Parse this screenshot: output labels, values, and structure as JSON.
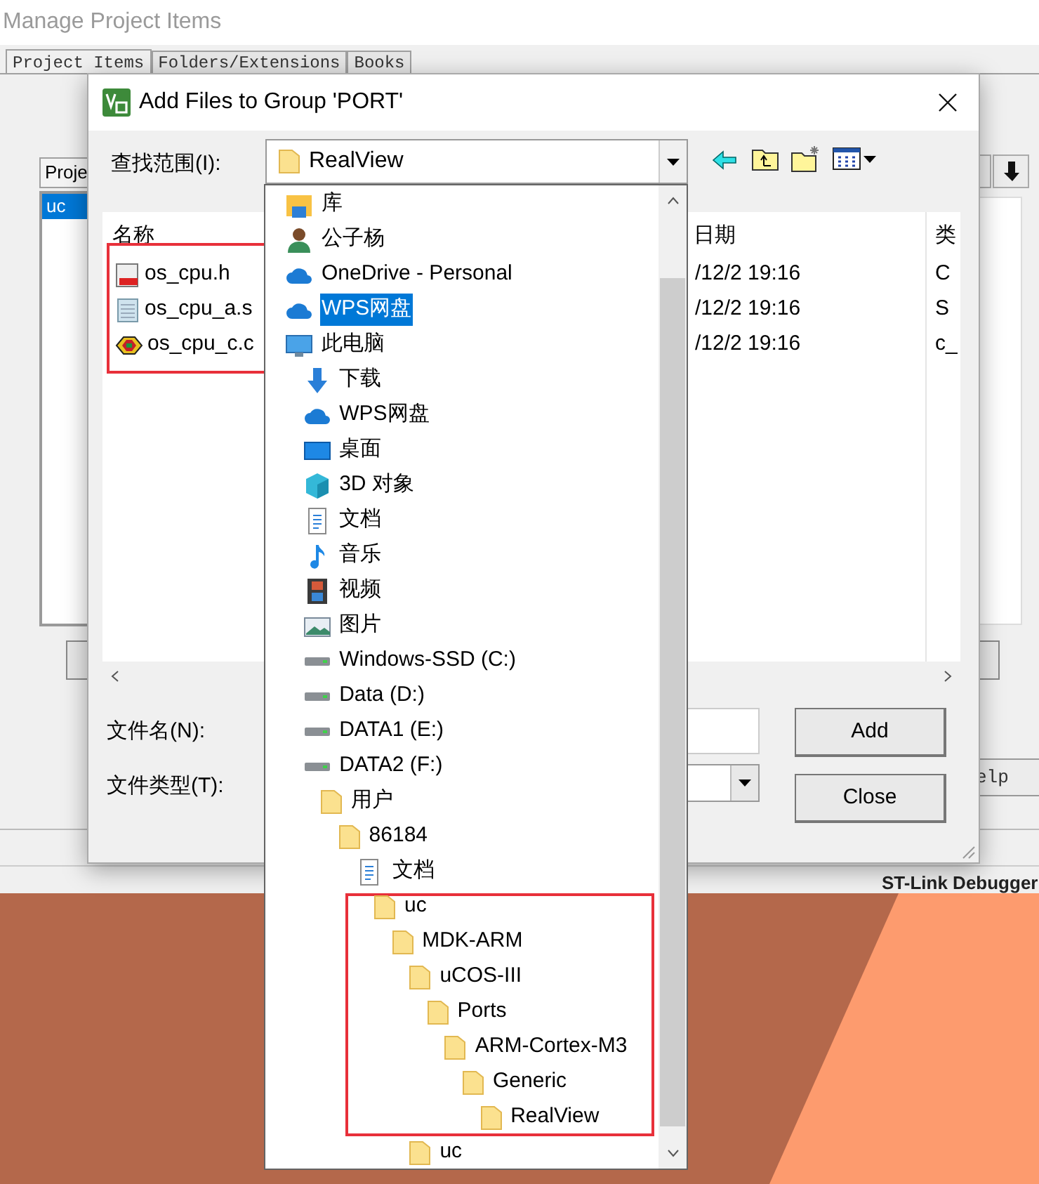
{
  "background_window": {
    "title": "Manage Project Items",
    "tabs": [
      {
        "label": "Project Items",
        "selected": true
      },
      {
        "label": "Folders/Extensions",
        "selected": false
      },
      {
        "label": "Books",
        "selected": false
      }
    ],
    "list_header": "Proje",
    "list_items": [
      {
        "label": "uc",
        "selected": true
      }
    ],
    "help_button": "elp",
    "status_bar": "ST-Link Debugger"
  },
  "dialog": {
    "title": "Add Files to Group 'PORT'",
    "look_in_label": "查找范围(I):",
    "look_in_value": "RealView",
    "columns": [
      "名称",
      "日期",
      "类"
    ],
    "files_framed": true,
    "files": [
      {
        "name": "os_cpu.h",
        "kind": "header",
        "date": "/12/2 19:16",
        "type": "C"
      },
      {
        "name": "os_cpu_a.s",
        "kind": "asm",
        "date": "/12/2 19:16",
        "type": "S"
      },
      {
        "name": "os_cpu_c.c",
        "kind": "c",
        "date": "/12/2 19:16",
        "type": "c_"
      }
    ],
    "file_name_label": "文件名(N):",
    "file_type_label": "文件类型(T):",
    "buttons": [
      "Add",
      "Close"
    ]
  },
  "dropdown": {
    "items": [
      {
        "label": "库",
        "kind": "library",
        "selected": false
      },
      {
        "label": "公子杨",
        "kind": "user",
        "selected": false
      },
      {
        "label": "OneDrive - Personal",
        "kind": "cloud",
        "selected": false
      },
      {
        "label": "WPS网盘",
        "kind": "cloud",
        "selected": true
      },
      {
        "label": "此电脑",
        "kind": "pc",
        "selected": false,
        "children": [
          {
            "label": "下载",
            "kind": "download",
            "selected": false
          },
          {
            "label": "WPS网盘",
            "kind": "cloud",
            "selected": false
          },
          {
            "label": "桌面",
            "kind": "desktop",
            "selected": false
          },
          {
            "label": "3D 对象",
            "kind": "cube",
            "selected": false
          },
          {
            "label": "文档",
            "kind": "document",
            "selected": false
          },
          {
            "label": "音乐",
            "kind": "music",
            "selected": false
          },
          {
            "label": "视频",
            "kind": "video",
            "selected": false
          },
          {
            "label": "图片",
            "kind": "image",
            "selected": false
          },
          {
            "label": "Windows-SSD (C:)",
            "kind": "drive",
            "selected": false
          },
          {
            "label": "Data (D:)",
            "kind": "drive",
            "selected": false
          },
          {
            "label": "DATA1 (E:)",
            "kind": "drive",
            "selected": false
          },
          {
            "label": "DATA2 (F:)",
            "kind": "drive",
            "selected": false,
            "children": [
              {
                "label": "用户",
                "kind": "folder",
                "selected": false,
                "children": [
                  {
                    "label": "86184",
                    "kind": "folder",
                    "selected": false,
                    "children": [
                      {
                        "label": "文档",
                        "kind": "document",
                        "selected": false,
                        "children": [
                          {
                            "label": "uc",
                            "kind": "folder",
                            "selected": false,
                            "framed": true,
                            "children": [
                              {
                                "label": "MDK-ARM",
                                "kind": "folder",
                                "selected": false,
                                "framed": true,
                                "children": [
                                  {
                                    "label": "uCOS-III",
                                    "kind": "folder",
                                    "selected": false,
                                    "framed": true,
                                    "children": [
                                      {
                                        "label": "Ports",
                                        "kind": "folder",
                                        "selected": false,
                                        "framed": true,
                                        "children": [
                                          {
                                            "label": "ARM-Cortex-M3",
                                            "kind": "folder",
                                            "selected": false,
                                            "framed": true,
                                            "children": [
                                              {
                                                "label": "Generic",
                                                "kind": "folder",
                                                "selected": false,
                                                "framed": true,
                                                "children": [
                                                  {
                                                    "label": "RealView",
                                                    "kind": "folder",
                                                    "selected": false,
                                                    "framed": true
                                                  }
                                                ]
                                              }
                                            ]
                                          }
                                        ]
                                      }
                                    ]
                                  },
                                  {
                                    "label": "uc",
                                    "kind": "folder",
                                    "selected": false,
                                    "framed": false
                                  }
                                ]
                              }
                            ]
                          }
                        ]
                      }
                    ]
                  }
                ]
              }
            ]
          }
        ]
      }
    ]
  }
}
